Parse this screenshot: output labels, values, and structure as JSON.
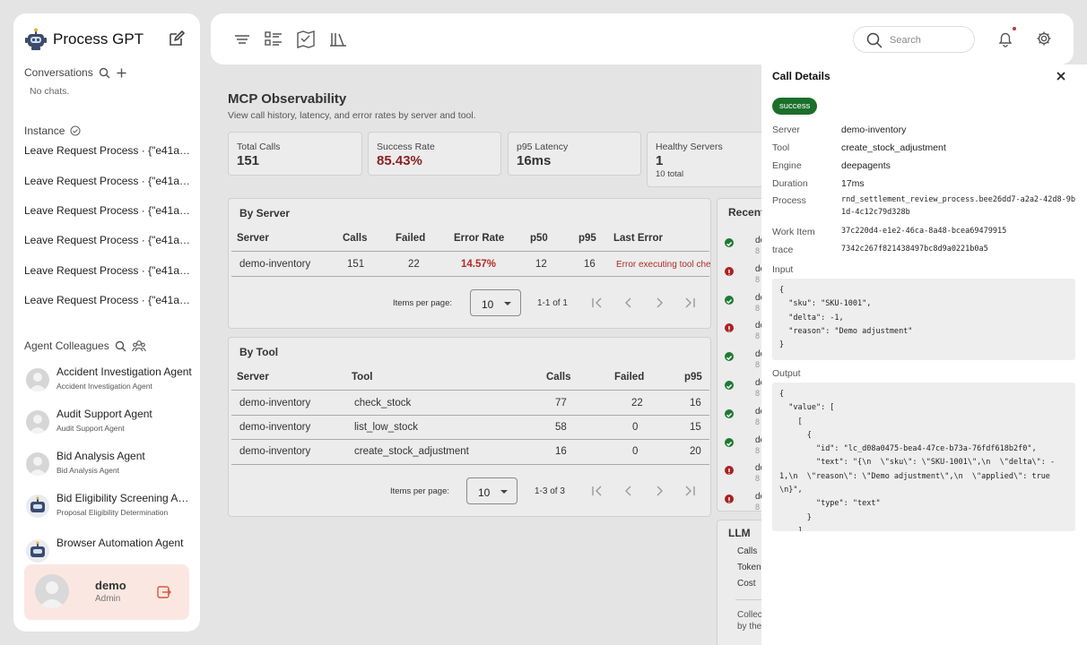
{
  "sidebar": {
    "brand": "Process GPT",
    "conversations_title": "Conversations",
    "no_chats": "No chats.",
    "instance_title": "Instance",
    "instances": [
      "Leave Request Process · {\"e41a53...",
      "Leave Request Process · {\"e41a53...",
      "Leave Request Process · {\"e41a53...",
      "Leave Request Process · {\"e41a53...",
      "Leave Request Process · {\"e41a53...",
      "Leave Request Process · {\"e41a53..."
    ],
    "agents_title": "Agent Colleagues",
    "agents": [
      {
        "name": "Accident Investigation Agent",
        "sub": "Accident Investigation Agent",
        "avatar": "user-avatar-icon"
      },
      {
        "name": "Audit Support Agent",
        "sub": "Audit Support Agent",
        "avatar": "user-avatar-icon"
      },
      {
        "name": "Bid Analysis Agent",
        "sub": "Bid Analysis Agent",
        "avatar": "user-avatar-icon"
      },
      {
        "name": "Bid Eligibility Screening Agent",
        "sub": "Proposal Eligibility Determination",
        "avatar": "robot-icon"
      },
      {
        "name": "Browser Automation Agent",
        "sub": "",
        "avatar": "robot-icon"
      }
    ],
    "user": {
      "name": "demo",
      "role": "Admin"
    }
  },
  "topbar": {
    "search_placeholder": "Search"
  },
  "main": {
    "title": "MCP Observability",
    "subtitle": "View call history, latency, and error rates by server and tool.",
    "stats": [
      {
        "label": "Total Calls",
        "value": "151",
        "sub": ""
      },
      {
        "label": "Success Rate",
        "value": "85.43%",
        "sub": ""
      },
      {
        "label": "p95 Latency",
        "value": "16ms",
        "sub": ""
      },
      {
        "label": "Healthy Servers",
        "value": "1",
        "sub": "10 total"
      }
    ],
    "by_server": {
      "title": "By Server",
      "headers": [
        "Server",
        "Calls",
        "Failed",
        "Error Rate",
        "p50",
        "p95",
        "Last Error"
      ],
      "rows": [
        {
          "server": "demo-inventory",
          "calls": "151",
          "failed": "22",
          "error_rate": "14.57%",
          "p50": "12",
          "p95": "16",
          "last_error": "Error executing tool che"
        }
      ],
      "items_per_page_label": "Items per page:",
      "per_page": "10",
      "range": "1-1 of 1"
    },
    "by_tool": {
      "title": "By Tool",
      "headers": [
        "Server",
        "Tool",
        "Calls",
        "Failed",
        "p95"
      ],
      "rows": [
        {
          "server": "demo-inventory",
          "tool": "check_stock",
          "calls": "77",
          "failed": "22",
          "p95": "16"
        },
        {
          "server": "demo-inventory",
          "tool": "list_low_stock",
          "calls": "58",
          "failed": "0",
          "p95": "15"
        },
        {
          "server": "demo-inventory",
          "tool": "create_stock_adjustment",
          "calls": "16",
          "failed": "0",
          "p95": "20"
        }
      ],
      "items_per_page_label": "Items per page:",
      "per_page": "10",
      "range": "1-3 of 3"
    },
    "recent": {
      "title": "Recent",
      "items": [
        {
          "status": "success",
          "t": "de",
          "s": "8"
        },
        {
          "status": "error",
          "t": "de",
          "s": "8"
        },
        {
          "status": "success",
          "t": "de",
          "s": "8"
        },
        {
          "status": "error",
          "t": "de",
          "s": "8"
        },
        {
          "status": "success",
          "t": "de",
          "s": "8"
        },
        {
          "status": "success",
          "t": "de",
          "s": "8"
        },
        {
          "status": "success",
          "t": "de",
          "s": "8"
        },
        {
          "status": "success",
          "t": "de",
          "s": "8"
        },
        {
          "status": "error",
          "t": "de",
          "s": "8"
        },
        {
          "status": "error",
          "t": "de",
          "s": "8"
        }
      ]
    },
    "llm": {
      "title": "LLM",
      "rows": [
        "Calls",
        "Token",
        "Cost"
      ],
      "note": [
        "Collec",
        "by the"
      ]
    }
  },
  "details": {
    "title": "Call Details",
    "status": "success",
    "fields": [
      {
        "key": "Server",
        "value": "demo-inventory",
        "mono": false
      },
      {
        "key": "Tool",
        "value": "create_stock_adjustment",
        "mono": false
      },
      {
        "key": "Engine",
        "value": "deepagents",
        "mono": false
      },
      {
        "key": "Duration",
        "value": "17ms",
        "mono": false
      },
      {
        "key": "Process",
        "value": "rnd_settlement_review_process.bee26dd7-a2a2-42d8-9b1d-4c12c79d328b",
        "mono": true
      },
      {
        "key": "Work Item",
        "value": "37c220d4-e1e2-46ca-8a48-bcea69479915",
        "mono": true
      },
      {
        "key": "trace",
        "value": "7342c267f821438497bc8d9a0221b0a5",
        "mono": true
      }
    ],
    "input_label": "Input",
    "input": "{\n  \"sku\": \"SKU-1001\",\n  \"delta\": -1,\n  \"reason\": \"Demo adjustment\"\n}",
    "output_label": "Output",
    "output": "{\n  \"value\": [\n    [\n      {\n        \"id\": \"lc_d08a0475-bea4-47ce-b73a-76fdf618b2f0\",\n        \"text\": \"{\\n  \\\"sku\\\": \\\"SKU-1001\\\",\\n  \\\"delta\\\": -1,\\n  \\\"reason\\\": \\\"Demo adjustment\\\",\\n  \\\"applied\\\": true\\n}\",\n        \"type\": \"text\"\n      }\n    ],\n    null"
  },
  "colors": {
    "success": "#1a6f2a",
    "error": "#a92222",
    "user_card": "#fbe7e1"
  }
}
